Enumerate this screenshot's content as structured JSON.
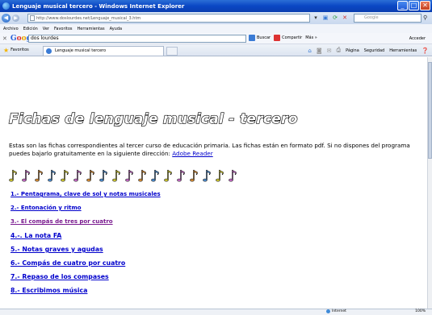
{
  "window": {
    "title": "Lenguaje musical tercero - Windows Internet Explorer",
    "controls": [
      "_",
      "□",
      "✕"
    ]
  },
  "addressbar": {
    "url": "http://www.doslourdes.net/Lenguaje_musical_3.htm",
    "search_placeholder": "Google"
  },
  "menu": [
    "Archivo",
    "Edición",
    "Ver",
    "Favoritos",
    "Herramientas",
    "Ayuda"
  ],
  "google_toolbar": {
    "query": "dos lourdes",
    "buttons": [
      "Buscar",
      "Compartir",
      "Más »"
    ],
    "acceder": "Acceder"
  },
  "tabs": {
    "favorites_label": "Favoritos",
    "active_tab": "Lenguaje musical tercero",
    "commands": [
      "Página",
      "Seguridad",
      "Herramientas"
    ]
  },
  "page": {
    "title": "Fichas de lenguaje musical - tercero",
    "intro_text": "Estas son las fichas correspondientes al tercer curso de educación primaria. Las fichas están en formato pdf. Si no dispones del programa puedes bajarlo gratuitamente en la siguiente dirección: ",
    "intro_link": "Adobe Reader",
    "note_colors": [
      "#e8e03a",
      "#e07be0",
      "#f0a040",
      "#5aa0e8",
      "#e8e03a",
      "#e07be0",
      "#f0a040",
      "#5aa0e8",
      "#e8e03a",
      "#e07be0",
      "#f0a040",
      "#5aa0e8",
      "#e8e03a",
      "#e07be0",
      "#f0a040",
      "#5aa0e8",
      "#e8e03a",
      "#e07be0"
    ],
    "links": [
      {
        "label": "1.- Pentagrama, clave de sol y notas musicales",
        "visited": false,
        "big": false
      },
      {
        "label": "2.- Entonación y ritmo",
        "visited": false,
        "big": false
      },
      {
        "label": "3.- El compás de tres por cuatro",
        "visited": true,
        "big": false
      },
      {
        "label": "4.-. La nota FA",
        "visited": false,
        "big": true
      },
      {
        "label": "5.- Notas graves y agudas",
        "visited": false,
        "big": true
      },
      {
        "label": "6.- Compás de cuatro por cuatro",
        "visited": false,
        "big": true
      },
      {
        "label": "7.- Repaso de los compases",
        "visited": false,
        "big": true
      },
      {
        "label": "8.- Escribimos música",
        "visited": false,
        "big": true
      }
    ]
  },
  "status": {
    "zone": "Internet",
    "zoom": "100%"
  }
}
